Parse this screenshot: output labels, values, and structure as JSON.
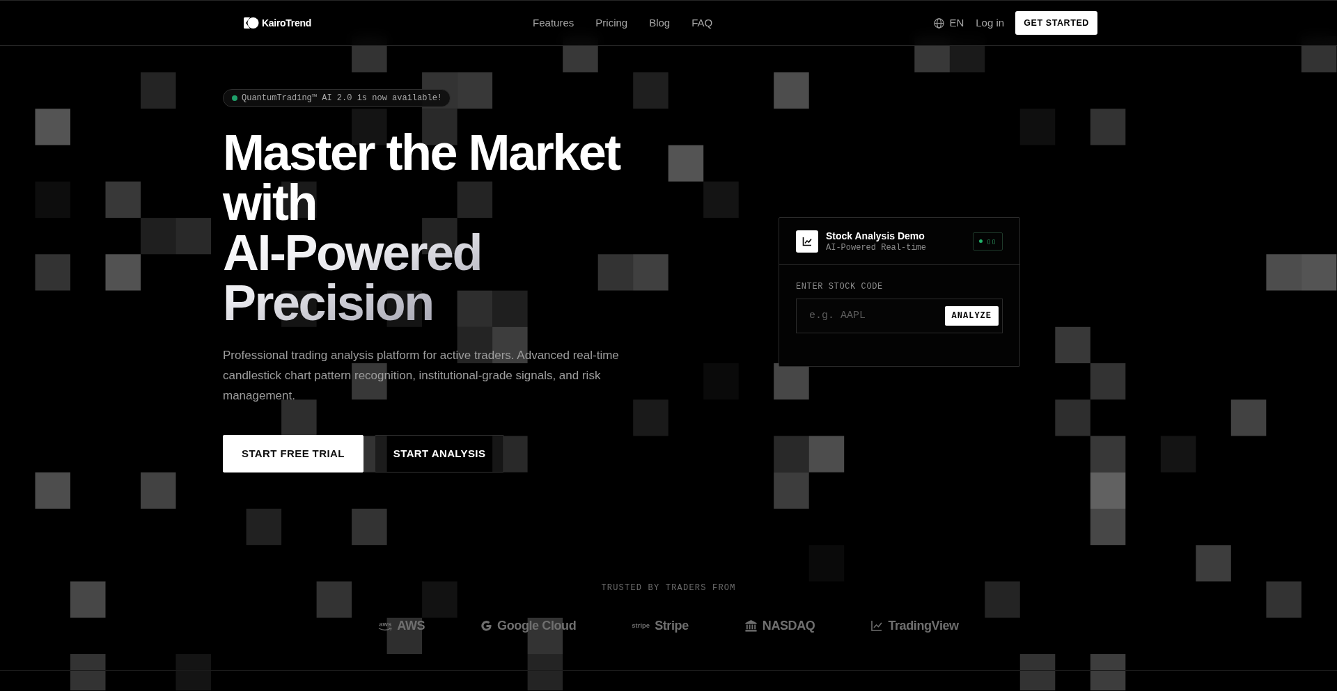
{
  "nav": {
    "logo": "KairoTrend",
    "links": [
      "Features",
      "Pricing",
      "Blog",
      "FAQ"
    ],
    "language": "EN",
    "login": "Log in",
    "cta": "GET STARTED"
  },
  "hero": {
    "badge": "QuantumTrading™ AI 2.0 is now available!",
    "heading": [
      "Master the Market with",
      "AI-Powered Precision"
    ],
    "description": "Professional trading analysis platform for active traders. Advanced real-time candlestick chart pattern recognition, institutional-grade signals, and risk management.",
    "buttons": [
      {
        "label": "START FREE TRIAL",
        "kind": "primary"
      },
      {
        "label": "START ANALYSIS",
        "kind": "outline"
      }
    ]
  },
  "demo_card": {
    "title": "Stock Analysis Demo",
    "subtitle": "AI-Powered Real-time",
    "status": "▯▯",
    "field_label": "ENTER STOCK CODE",
    "placeholder": "e.g. AAPL",
    "button": "ANALYZE"
  },
  "trusted": {
    "label": "TRUSTED BY TRADERS FROM",
    "logos": [
      {
        "kind": "aws",
        "mark": "aws",
        "name": "AWS"
      },
      {
        "kind": "google",
        "name": "Google Cloud"
      },
      {
        "kind": "stripe",
        "mark": "stripe",
        "name": "Stripe"
      },
      {
        "kind": "bank",
        "name": "NASDAQ"
      },
      {
        "kind": "chart",
        "name": "TradingView"
      }
    ]
  }
}
